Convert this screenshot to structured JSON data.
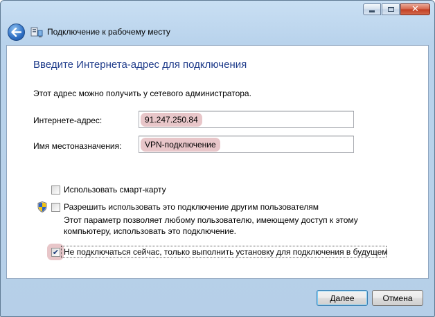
{
  "window": {
    "title": "Подключение к рабочему месту",
    "icons": {
      "back": "back-arrow-icon",
      "app": "network-connection-icon",
      "minimize": "minimize-icon",
      "maximize": "maximize-icon",
      "close": "close-icon"
    },
    "close_glyph": "✕"
  },
  "page": {
    "heading": "Введите Интернета-адрес для подключения",
    "info": "Этот адрес можно получить у сетевого администратора."
  },
  "fields": {
    "address": {
      "label": "Интернете-адрес:",
      "value": "91.247.250.84"
    },
    "destination": {
      "label": "Имя местоназначения:",
      "value": "VPN-подключение"
    }
  },
  "options": {
    "smartcard": {
      "label": "Использовать смарт-карту",
      "checked": false
    },
    "allow_others": {
      "label": "Разрешить использовать это подключение другим пользователям",
      "checked": false,
      "icon": "uac-shield-icon",
      "description": "Этот параметр позволяет любому пользователю, имеющему доступ к этому компьютеру, использовать это подключение."
    },
    "dont_connect": {
      "label": "Не подключаться сейчас, только выполнить установку для подключения в будущем",
      "checked": true,
      "check_glyph": "✔"
    }
  },
  "buttons": {
    "next": "Далее",
    "cancel": "Отмена"
  },
  "colors": {
    "heading": "#1e3b8a",
    "highlight": "#e8c6c9",
    "frame": "#b9d3ec"
  }
}
